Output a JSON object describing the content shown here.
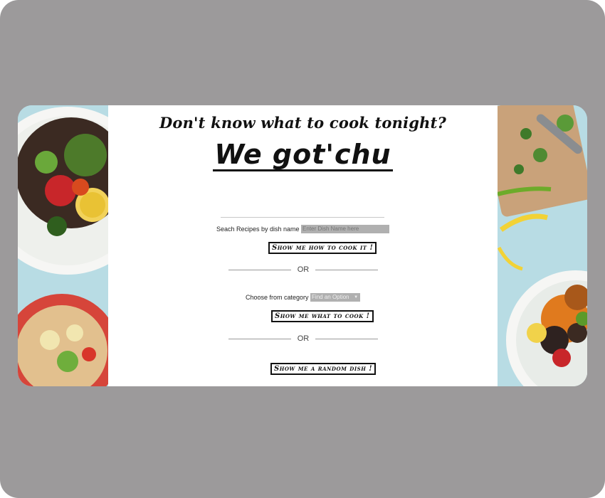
{
  "hero": {
    "tagline": "Don't know what to cook tonight?",
    "headline": "We got'chu"
  },
  "search": {
    "label": "Seach Recipes by dish name",
    "placeholder": "Enter Dish Name here",
    "button": "Show me how to cook it !"
  },
  "divider_or": "OR",
  "category": {
    "label": "Choose from category",
    "selected": "Find an Option",
    "button": "Show me what to cook !"
  },
  "random": {
    "button": "Show me a random dish !"
  },
  "colors": {
    "frame": "#9c9a9b",
    "panel": "#ffffff",
    "input": "#b0b0b0"
  },
  "icons": {
    "select_chevron": "chevron-down-icon"
  }
}
